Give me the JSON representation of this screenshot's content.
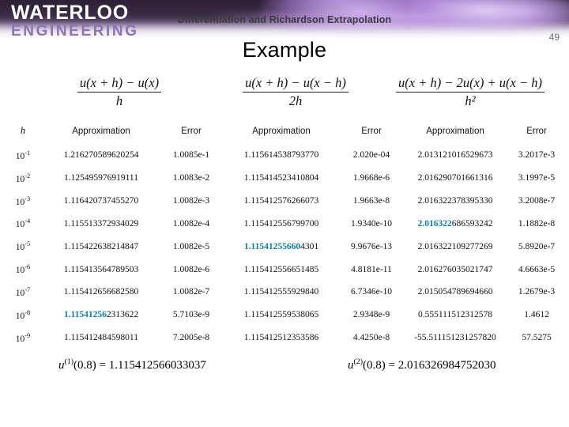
{
  "banner": {
    "logo_line1": "WATERLOO",
    "logo_line2": "ENGINEERING",
    "logo_line1_color": "#ffffff",
    "logo_line2_color": "#8d73b4"
  },
  "header": {
    "subtitle": "Differentiation and Richardson Extrapolation",
    "title": "Example",
    "page_number": "49"
  },
  "formulas": [
    {
      "numerator": "u(x + h) − u(x)",
      "denominator": "h"
    },
    {
      "numerator": "u(x + h) − u(x − h)",
      "denominator": "2h"
    },
    {
      "numerator": "u(x + h) − 2u(x) + u(x − h)",
      "denominator": "h²"
    }
  ],
  "table": {
    "headers": {
      "h": "h",
      "approximation": "Approximation",
      "error": "Error"
    },
    "rows": [
      {
        "h_base": "10",
        "h_exp": "-1",
        "approx1": "1.216270589620254",
        "error1": "1.0085e-1",
        "approx2": "1.115614538793770",
        "error2": "2.020e-04",
        "approx3": "2.013121016529673",
        "error3": "3.2017e-3",
        "color1": "black",
        "color2": "black",
        "color3": "black",
        "bold_prefix1": "",
        "bold_prefix2": "",
        "bold_prefix3": ""
      },
      {
        "h_base": "10",
        "h_exp": "-2",
        "approx1": "1.125495976919111",
        "error1": "1.0083e-2",
        "approx2": "1.115414523410804",
        "error2": "1.9668e-6",
        "approx3": "2.016290701661316",
        "error3": "3.1997e-5",
        "color1": "black",
        "color2": "black",
        "color3": "black",
        "bold_prefix1": "",
        "bold_prefix2": "",
        "bold_prefix3": ""
      },
      {
        "h_base": "10",
        "h_exp": "-3",
        "approx1": "1.116420737455270",
        "error1": "1.0082e-3",
        "approx2": "1.115412576266073",
        "error2": "1.9663e-8",
        "approx3": "2.016322378395330",
        "error3": "3.2008e-7",
        "color1": "black",
        "color2": "black",
        "color3": "black",
        "bold_prefix1": "",
        "bold_prefix2": "",
        "bold_prefix3": ""
      },
      {
        "h_base": "10",
        "h_exp": "-4",
        "approx1": "1.115513372934029",
        "error1": "1.0082e-4",
        "approx2": "1.115412556799700",
        "error2": "1.9340e-10",
        "approx3": "2.016322686593242",
        "error3": "1.1882e-8",
        "color1": "black",
        "color2": "black",
        "color3": "teal",
        "bold_prefix1": "",
        "bold_prefix2": "",
        "bold_prefix3": "2.016322"
      },
      {
        "h_base": "10",
        "h_exp": "-5",
        "approx1": "1.115422638214847",
        "error1": "1.0082e-5",
        "approx2": "1.115412556604301",
        "error2": "9.9676e-13",
        "approx3": "2.016322109277269",
        "error3": "5.8920e-7",
        "color1": "black",
        "color2": "teal",
        "color3": "red",
        "bold_prefix1": "",
        "bold_prefix2": "1.11541255660",
        "bold_prefix3": ""
      },
      {
        "h_base": "10",
        "h_exp": "-6",
        "approx1": "1.115413564789503",
        "error1": "1.0082e-6",
        "approx2": "1.115412556651485",
        "error2": "4.8181e-11",
        "approx3": "2.016276035021747",
        "error3": "4.6663e-5",
        "color1": "black",
        "color2": "red",
        "color3": "red",
        "bold_prefix1": "",
        "bold_prefix2": "",
        "bold_prefix3": ""
      },
      {
        "h_base": "10",
        "h_exp": "-7",
        "approx1": "1.115412656682580",
        "error1": "1.0082e-7",
        "approx2": "1.115412555929840",
        "error2": "6.7346e-10",
        "approx3": "2.015054789694660",
        "error3": "1.2679e-3",
        "color1": "black",
        "color2": "red",
        "color3": "red",
        "bold_prefix1": "",
        "bold_prefix2": "",
        "bold_prefix3": ""
      },
      {
        "h_base": "10",
        "h_exp": "-8",
        "approx1": "1.115412562313622",
        "error1": "5.7103e-9",
        "approx2": "1.115412559538065",
        "error2": "2.9348e-9",
        "approx3": "0.555111512312578",
        "error3": "1.4612",
        "color1": "teal",
        "color2": "red",
        "color3": "red",
        "bold_prefix1": "1.11541256",
        "bold_prefix2": "",
        "bold_prefix3": ""
      },
      {
        "h_base": "10",
        "h_exp": "-9",
        "approx1": "1.115412484598011",
        "error1": "7.2005e-8",
        "approx2": "1.115412512353586",
        "error2": "4.4250e-8",
        "approx3": "-55.511151231257820",
        "error3": "57.5275",
        "color1": "red",
        "color2": "red",
        "color3": "red",
        "bold_prefix1": "",
        "bold_prefix2": "",
        "bold_prefix3": ""
      }
    ]
  },
  "footer": {
    "left_equation_var": "u",
    "left_equation_sup": "(1)",
    "left_equation_rest": "(0.8) = 1.115412566033037",
    "right_equation_var": "u",
    "right_equation_sup": "(2)",
    "right_equation_rest": "(0.8) = 2.016326984752030"
  },
  "colors": {
    "teal": "#5ab4d2",
    "teal_bold": "#0b7fa8",
    "red": "#8e2121",
    "black": "#111111"
  }
}
